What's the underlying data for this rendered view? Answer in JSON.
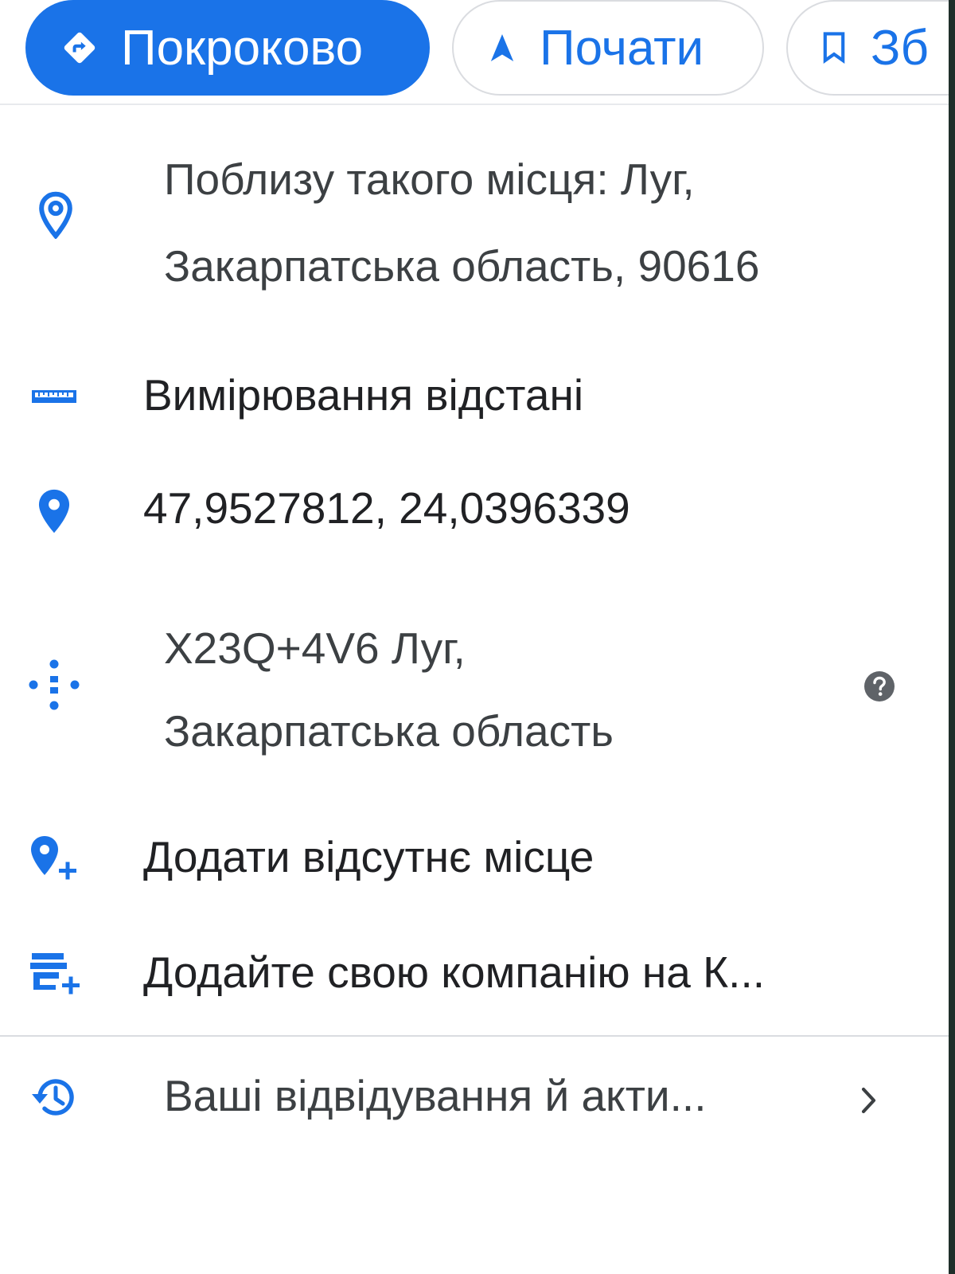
{
  "chips": {
    "directions_label": "Покроково",
    "start_label": "Почати",
    "save_label": "Зб"
  },
  "place": {
    "nearby_line1": "Поблизу такого місця: Луг,",
    "nearby_line2": "Закарпатська область, 90616",
    "measure_distance": "Вимірювання відстані",
    "coordinates": "47,9527812, 24,0396339",
    "plus_code_line1": "X23Q+4V6 Луг,",
    "plus_code_line2": "Закарпатська область",
    "add_missing_place": "Додати відсутнє місце",
    "add_business": "Додайте свою компанію на К...",
    "visits_activity": "Ваші відвідування й акти..."
  },
  "icons": {
    "directions": "directions-icon",
    "start": "navigation-arrow-icon",
    "save": "bookmark-icon",
    "nearby": "location-outline-icon",
    "measure": "ruler-icon",
    "coordinates": "location-pin-icon",
    "plus_code": "plus-code-icon",
    "plus_code_help": "help-icon",
    "add_place": "add-location-icon",
    "add_business": "add-business-icon",
    "visits": "history-icon",
    "visits_chevron": "chevron-right-icon"
  },
  "colors": {
    "accent": "#1a73e8",
    "text": "#202124",
    "secondary_text": "#3c4043",
    "help_icon": "#5f6368",
    "divider": "#dadce0"
  }
}
